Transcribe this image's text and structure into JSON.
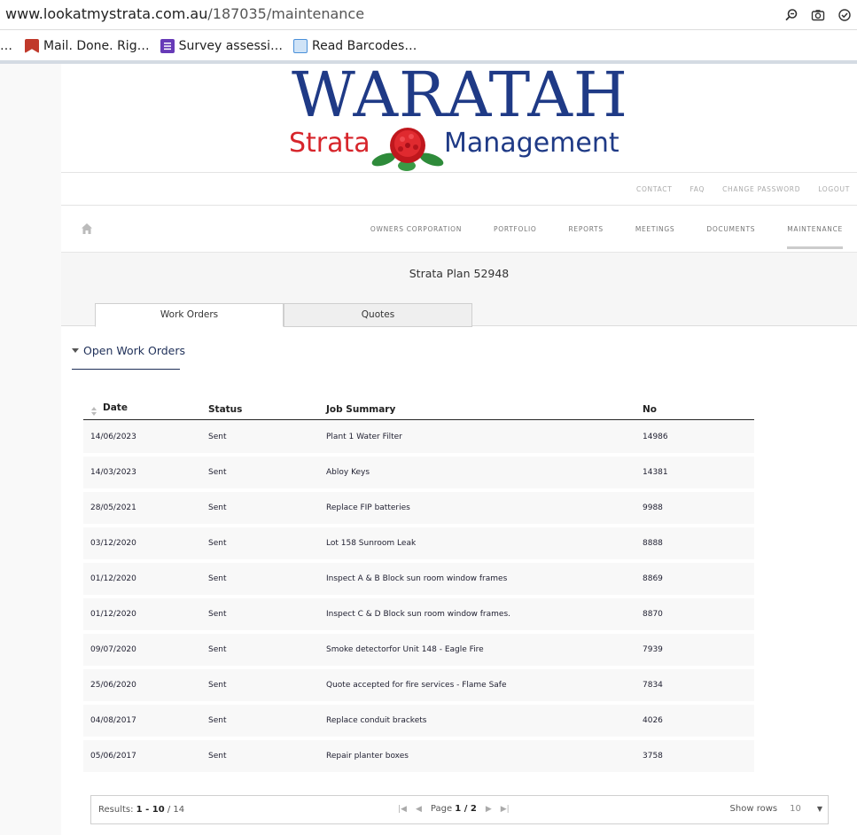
{
  "browser": {
    "url_domain": "www.lookatmystrata.com.au",
    "url_path": "/187035/maintenance",
    "bookmarks": [
      {
        "label": "Mail. Done. Rig…",
        "color": "#c0392b"
      },
      {
        "label": "Survey assessi…",
        "color": "#673ab7"
      },
      {
        "label": "Read Barcodes…",
        "color": "#4a90d9"
      }
    ],
    "bookmarks_prefix": "…"
  },
  "logo": {
    "title": "WARATAH",
    "word1": "Strata",
    "word2": "Management"
  },
  "toplinks": [
    "CONTACT",
    "FAQ",
    "CHANGE PASSWORD",
    "LOGOUT"
  ],
  "nav": {
    "items": [
      "OWNERS CORPORATION",
      "PORTFOLIO",
      "REPORTS",
      "MEETINGS",
      "DOCUMENTS",
      "MAINTENANCE"
    ],
    "active": "MAINTENANCE"
  },
  "strata_plan": "Strata Plan 52948",
  "tabs": [
    "Work Orders",
    "Quotes"
  ],
  "section_title": "Open Work Orders",
  "table": {
    "headers": [
      "Date",
      "Status",
      "Job Summary",
      "No"
    ],
    "rows": [
      [
        "14/06/2023",
        "Sent",
        "Plant 1 Water Filter",
        "14986"
      ],
      [
        "14/03/2023",
        "Sent",
        "Abloy Keys",
        "14381"
      ],
      [
        "28/05/2021",
        "Sent",
        "Replace FIP batteries",
        "9988"
      ],
      [
        "03/12/2020",
        "Sent",
        "Lot 158 Sunroom Leak",
        "8888"
      ],
      [
        "01/12/2020",
        "Sent",
        "Inspect A & B Block sun room window frames",
        "8869"
      ],
      [
        "01/12/2020",
        "Sent",
        "Inspect C & D Block sun room window frames.",
        "8870"
      ],
      [
        "09/07/2020",
        "Sent",
        "Smoke detectorfor Unit 148 - Eagle Fire",
        "7939"
      ],
      [
        "25/06/2020",
        "Sent",
        "Quote accepted for fire services - Flame Safe",
        "7834"
      ],
      [
        "04/08/2017",
        "Sent",
        "Replace conduit brackets",
        "4026"
      ],
      [
        "05/06/2017",
        "Sent",
        "Repair planter boxes",
        "3758"
      ]
    ]
  },
  "pager": {
    "results_label": "Results:",
    "results_range": "1 - 10",
    "results_total": "/ 14",
    "page_label": "Page",
    "page_value": "1 / 2",
    "show_rows_label": "Show rows",
    "show_rows_value": "10"
  }
}
